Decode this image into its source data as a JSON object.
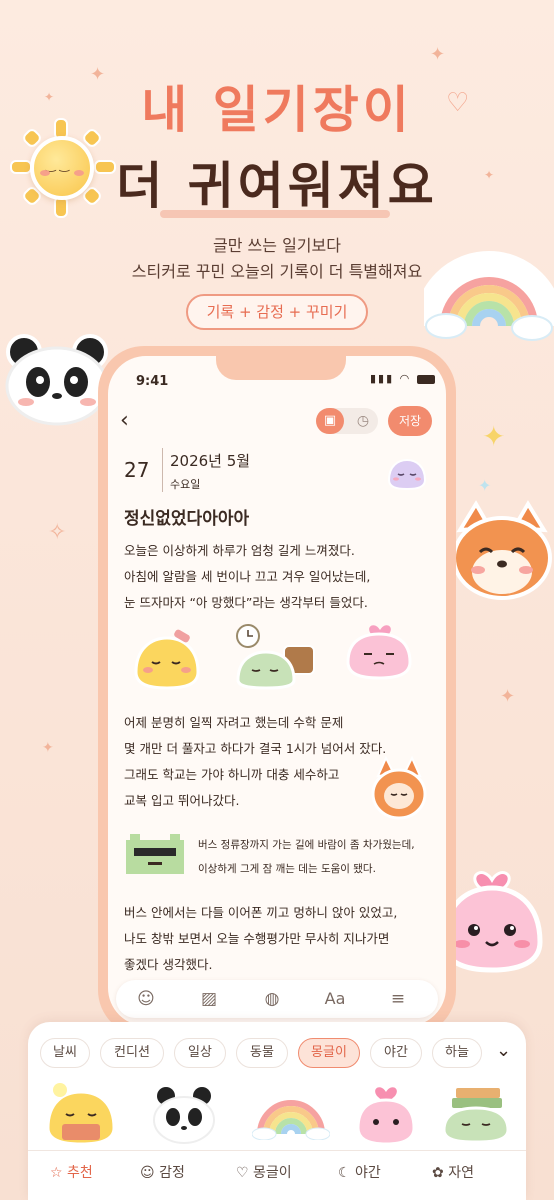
{
  "hero": {
    "title_line1": "내 일기장이",
    "title_line2": "더 귀여워져요",
    "subtitle_line1": "글만 쓰는 일기보다",
    "subtitle_line2": "스티커로 꾸민 오늘의 기록이 더 특별해져요",
    "pill": "기록 + 감정 + 꾸미기"
  },
  "status_bar": {
    "time": "9:41"
  },
  "editor": {
    "save_label": "저장",
    "day": "27",
    "year_month": "2026년 5월",
    "weekday": "수요일",
    "title": "정신없었다아아아",
    "paragraphs": [
      [
        "오늘은 이상하게 하루가 엄청 길게 느껴졌다.",
        "아침에 알람을 세 번이나 끄고 겨우 일어났는데,",
        "눈 뜨자마자 “아 망했다”라는 생각부터 들었다."
      ],
      [
        "어제 분명히 일찍 자려고 했는데 수학 문제",
        "몇 개만 더 풀자고 하다가 결국 1시가 넘어서 잤다.",
        "그래도 학교는 가야 하니까 대충 세수하고",
        "교복 입고 뛰어나갔다."
      ],
      [
        "버스 정류장까지 가는 길에 바람이 좀 차가웠는데,",
        "이상하게 그게 잠 깨는 데는 도움이 됐다."
      ],
      [
        "버스 안에서는 다들 이어폰 끼고 멍하니 앉아 있었고,",
        "나도 창밖 보면서 오늘 수행평가만 무사히 지나가면",
        "좋겠다 생각했다."
      ]
    ],
    "toolbar_text_label": "Aa"
  },
  "sticker_tray": {
    "categories": [
      "날씨",
      "컨디션",
      "일상",
      "동물",
      "몽글이",
      "야간",
      "하늘"
    ],
    "active_category": "몽글이",
    "bottom_nav": [
      "추천",
      "감정",
      "몽글이",
      "야간",
      "자연"
    ],
    "active_nav": "추천"
  },
  "colors": {
    "accent": "#f28b6e",
    "title_coral": "#ef7a5e",
    "title_brown": "#4b2a1e",
    "background": "#fdebe0"
  }
}
